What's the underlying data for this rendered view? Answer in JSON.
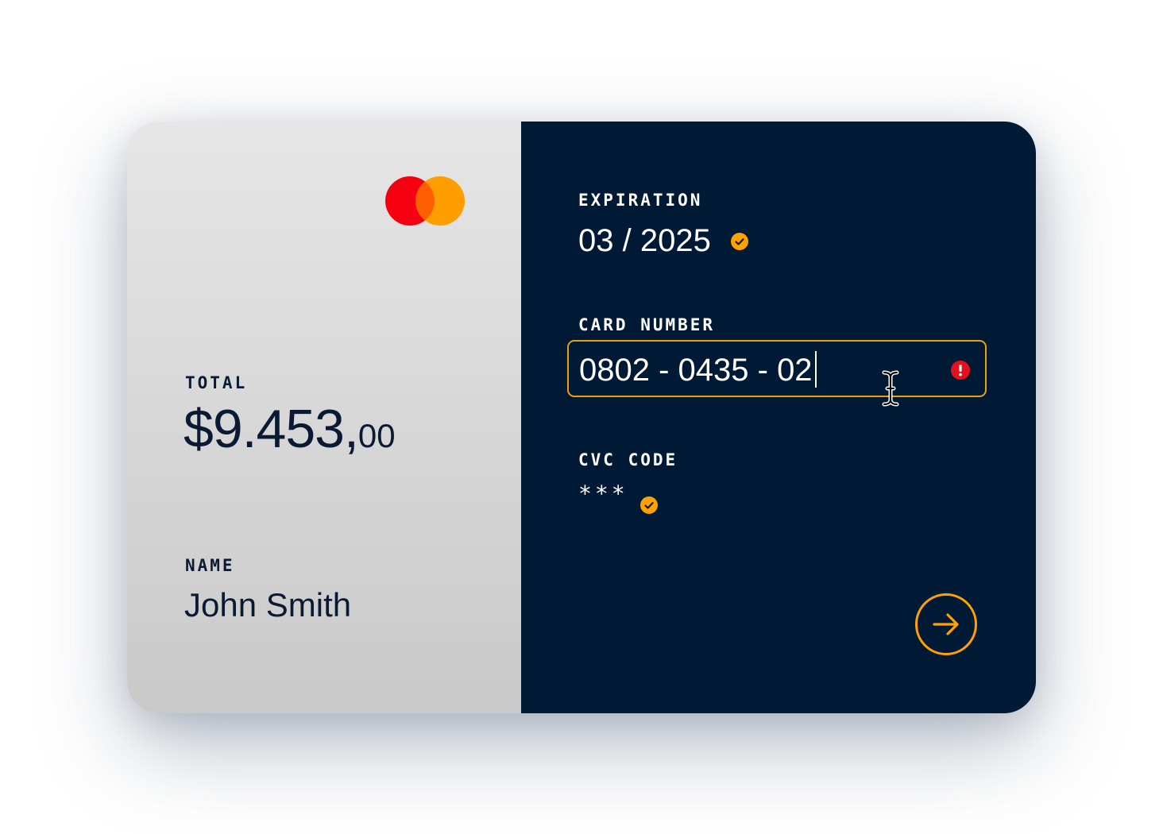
{
  "summary": {
    "total_label": "TOTAL",
    "total_main": "$9.453,",
    "total_cents": "00",
    "name_label": "NAME",
    "name_value": "John Smith"
  },
  "payment_form": {
    "expiration_label": "EXPIRATION",
    "expiration_value": "03 / 2025",
    "expiration_status": "valid",
    "card_number_label": "CARD NUMBER",
    "card_number_value": "0802 - 0435 - 02",
    "card_number_status": "error",
    "cvc_label": "CVC CODE",
    "cvc_value": "***",
    "cvc_status": "valid"
  },
  "icons": {
    "brand_logo": "mastercard-logo",
    "valid": "check-circle-icon",
    "error": "exclamation-circle-icon",
    "submit": "arrow-right-icon",
    "cursor": "text-cursor-icon"
  },
  "colors": {
    "panel_dark": "#001935",
    "accent": "#ffa200",
    "error": "#e5101e",
    "logo_red": "#eb001b",
    "logo_orange": "#f79e1b",
    "text_dark": "#0b1a33"
  }
}
